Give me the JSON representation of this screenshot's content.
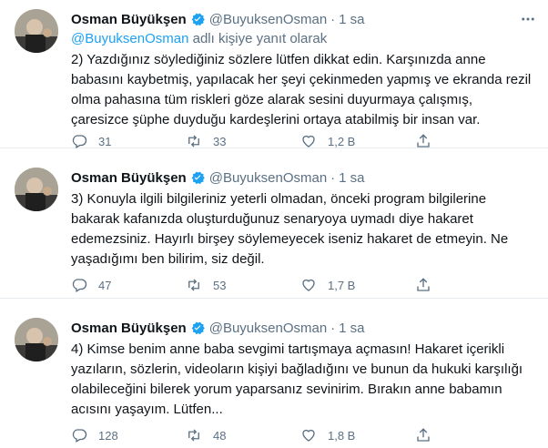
{
  "tweets": [
    {
      "author": {
        "name": "Osman Büyükşen",
        "handle": "@BuyuksenOsman",
        "time": "1 sa"
      },
      "reply_to": {
        "mention": "@BuyuksenOsman",
        "suffix": " adlı kişiye yanıt olarak"
      },
      "text": "2) Yazdığınız söylediğiniz sözlere lütfen dikkat edin. Karşınızda anne babasını kaybetmiş, yapılacak her şeyi çekinmeden yapmış ve ekranda rezil olma pahasına tüm riskleri göze alarak sesini duyurmaya çalışmış, çaresizce şüphe duyduğu kardeşlerini ortaya atabilmiş bir insan var.",
      "stats": {
        "replies": "31",
        "retweets": "33",
        "likes": "1,2 B"
      }
    },
    {
      "author": {
        "name": "Osman Büyükşen",
        "handle": "@BuyuksenOsman",
        "time": "1 sa"
      },
      "text": "3) Konuyla ilgili bilgileriniz yeterli olmadan, önceki program bilgilerine bakarak kafanızda oluşturduğunuz senaryoya uymadı diye hakaret edemezsiniz. Hayırlı birşey söylemeyecek iseniz hakaret de etmeyin. Ne yaşadığımı ben bilirim, siz değil.",
      "stats": {
        "replies": "47",
        "retweets": "53",
        "likes": "1,7 B"
      }
    },
    {
      "author": {
        "name": "Osman Büyükşen",
        "handle": "@BuyuksenOsman",
        "time": "1 sa"
      },
      "text": "4) Kimse benim anne baba sevgimi tartışmaya açmasın! Hakaret içerikli yazıların, sözlerin, videoların kişiyi bağladığını ve bunun da hukuki karşılığı olabileceğini bilerek yorum yaparsanız sevinirim. Bırakın anne babamın acısını yaşayım. Lütfen...",
      "stats": {
        "replies": "128",
        "retweets": "48",
        "likes": "1,8 B"
      }
    }
  ],
  "icons": {
    "verified": "verified-badge-icon",
    "more": "more-options-icon",
    "reply": "reply-icon",
    "retweet": "retweet-icon",
    "like": "like-icon",
    "share": "share-icon"
  },
  "colors": {
    "accent": "#1da1f2",
    "secondary_text": "#5b7083",
    "primary_text": "#0f1419"
  }
}
